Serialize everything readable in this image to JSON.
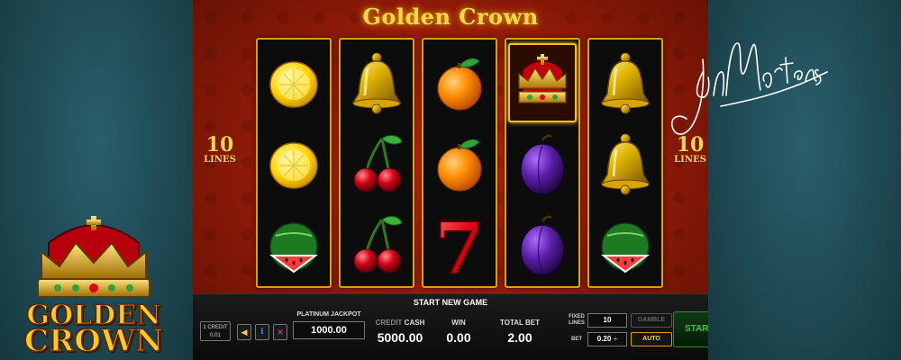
{
  "game_title": "Golden Crown",
  "lines": {
    "count": "10",
    "label": "LINES"
  },
  "reels": [
    [
      "lemon-icon",
      "lemon-icon",
      "watermelon-icon"
    ],
    [
      "bell-icon",
      "cherry-icon",
      "cherry-icon"
    ],
    [
      "orange-icon",
      "orange-icon",
      "seven-icon"
    ],
    [
      "crown-icon",
      "plum-icon",
      "plum-icon"
    ],
    [
      "bell-icon",
      "bell-icon",
      "watermelon-icon"
    ]
  ],
  "seven_glyph": "7",
  "panel": {
    "status": "START NEW GAME",
    "credit_line1": "1 CREDIT",
    "credit_line2": "0.01",
    "jackpot_label": "PLATINUM JACKPOT",
    "jackpot_value": "1000.00",
    "credit_label_dim": "CREDIT",
    "cash_label": "CASH",
    "cash_value": "5000.00",
    "win_label": "WIN",
    "win_value": "0.00",
    "total_bet_label": "TOTAL BET",
    "total_bet_value": "2.00",
    "fixed_label_1": "FIXED",
    "fixed_label_2": "LINES",
    "fixed_lines_value": "10",
    "bet_label": "BET",
    "bet_value": "0.20",
    "bet_plus": "+",
    "gamble_label": "GAMBLE",
    "auto_label": "AUTO",
    "start_label": "START",
    "info_glyph": "i"
  },
  "logo": {
    "line1": "GOLDEN",
    "line2": "CROWN"
  },
  "signature": "JanMartens",
  "colors": {
    "gold": "#ffd34d",
    "felt_red": "#c22a0f",
    "start_green": "#2ecc40",
    "panel_black": "#0c0c0c"
  }
}
